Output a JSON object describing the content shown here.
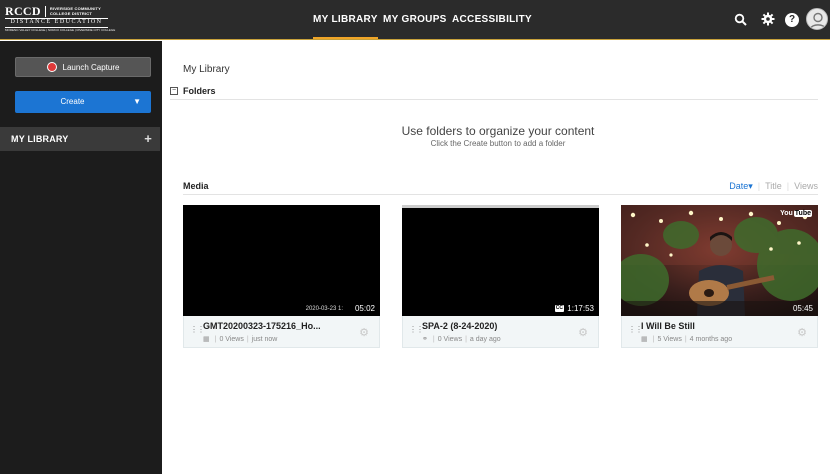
{
  "header": {
    "logo": {
      "main": "RCCD",
      "college_line1": "RIVERSIDE COMMUNITY",
      "college_line2": "COLLEGE DISTRICT",
      "tagline": "DISTANCE EDUCATION",
      "colleges": "MORENO VALLEY COLLEGE | NORCO COLLEGE | RIVERSIDE CITY COLLEGE"
    },
    "nav": [
      {
        "label": "MY LIBRARY",
        "active": true
      },
      {
        "label": "MY GROUPS",
        "active": false
      },
      {
        "label": "ACCESSIBILITY",
        "active": false
      }
    ],
    "icons": [
      "search-icon",
      "gear-icon",
      "help-icon",
      "avatar"
    ],
    "accent_color": "#f0a427"
  },
  "sidebar": {
    "launch_capture_label": "Launch Capture",
    "create_label": "Create",
    "create_caret": "▼",
    "my_library_label": "MY LIBRARY",
    "add_symbol": "+"
  },
  "main": {
    "breadcrumb": "My Library",
    "folders": {
      "toggle": "−",
      "title": "Folders",
      "empty_title": "Use folders to organize your content",
      "empty_subtitle": "Click the Create button to add a folder"
    },
    "media": {
      "title": "Media",
      "sort": {
        "date": "Date",
        "date_caret": "▾",
        "title": "Title",
        "views": "Views"
      },
      "items": [
        {
          "title": "GMT20200323-175216_Ho...",
          "views": "0 Views",
          "time": "just now",
          "duration": "05:02",
          "timestamp": "2020-03-23 1:",
          "type_icon": "grid-icon"
        },
        {
          "title": "SPA-2 (8-24-2020)",
          "views": "0 Views",
          "time": "a day ago",
          "duration": "1:17:53",
          "cc": "CC",
          "type_icon": "link-icon"
        },
        {
          "title": "I Will Be Still",
          "views": "5 Views",
          "time": "4 months ago",
          "duration": "05:45",
          "badge": "You",
          "badge_tube": "Tube",
          "type_icon": "grid-icon"
        }
      ]
    }
  }
}
